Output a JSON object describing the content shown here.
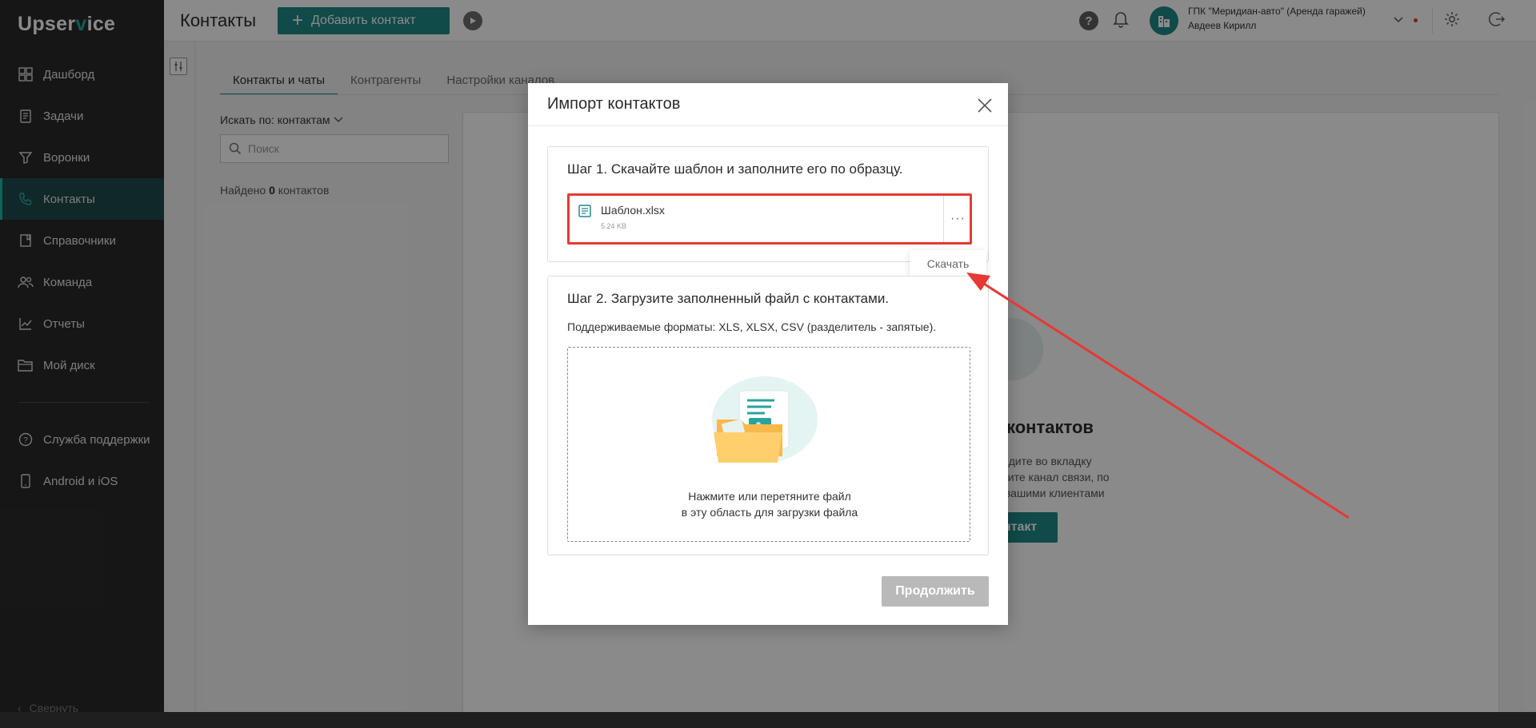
{
  "sidebar": {
    "logo_left": "Upser",
    "logo_accent": "v",
    "logo_right": "ice",
    "items": [
      {
        "label": "Дашборд",
        "icon": "dashboard-icon"
      },
      {
        "label": "Задачи",
        "icon": "tasks-icon"
      },
      {
        "label": "Воронки",
        "icon": "funnel-icon"
      },
      {
        "label": "Контакты",
        "icon": "phone-contacts-icon",
        "active": true
      },
      {
        "label": "Справочники",
        "icon": "book-icon"
      },
      {
        "label": "Команда",
        "icon": "team-icon"
      },
      {
        "label": "Отчеты",
        "icon": "chart-line-icon"
      },
      {
        "label": "Мой диск",
        "icon": "folder-icon"
      }
    ],
    "secondary": [
      {
        "label": "Служба поддержки",
        "icon": "help-circle-icon"
      },
      {
        "label": "Android и iOS",
        "icon": "phone-device-icon"
      }
    ],
    "collapse_label": "Свернуть"
  },
  "header": {
    "title": "Контакты",
    "add_button": "Добавить контакт",
    "org_name": "ГПК \"Меридиан-авто\" (Аренда гаражей)",
    "user_name": "Авдеев Кирилл",
    "accent_color": "#1f8a87"
  },
  "content": {
    "tabs": [
      "Контакты и чаты",
      "Контрагенты",
      "Настройки каналов"
    ],
    "search_by": "Искать по: контактам",
    "search_placeholder": "Поиск",
    "found_prefix": "Найдено ",
    "found_count": "0",
    "found_suffix": " контактов",
    "empty_title": "контактов",
    "empty_text_1": "ейдите во вкладку",
    "empty_text_2": "очите канал связи, по",
    "empty_text_3": "с вашими клиентами",
    "empty_button": "нтакт"
  },
  "modal": {
    "title": "Импорт контактов",
    "step1_title": "Шаг 1. Скачайте шаблон и заполните его по образцу.",
    "file_name": "Шаблон.xlsx",
    "file_size": "5.24 KB",
    "more_label": "···",
    "download_label": "Скачать",
    "step2_title": "Шаг 2. Загрузите заполненный файл с контактами.",
    "formats_text": "Поддерживаемые форматы: XLS, XLSX, CSV (разделитель - запятые).",
    "dropzone_line1": "Нажмите или перетяните файл",
    "dropzone_line2": "в эту область для загрузки файла",
    "continue_button": "Продолжить",
    "highlight_color": "#e53935"
  }
}
